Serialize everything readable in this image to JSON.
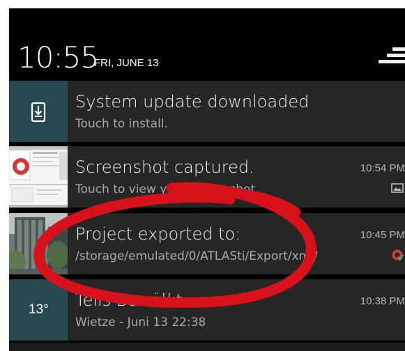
{
  "header": {
    "time": "10:55",
    "date": "FRI, JUNE 13"
  },
  "notifications": [
    {
      "title": "System update downloaded",
      "subtitle": "Touch to install.",
      "time": "",
      "icon": "download-icon"
    },
    {
      "title": "Screenshot captured.",
      "subtitle": "Touch to view your screenshot.",
      "time": "10:54 PM",
      "icon": "image-icon"
    },
    {
      "title": "Project exported to:",
      "subtitle": "/storage/emulated/0/ATLASti/Export/xml/",
      "time": "10:45 PM",
      "icon": "atlas-ti-icon"
    },
    {
      "title": "Teils Bewölkt",
      "subtitle": "Wietze - Juni 13  22:38",
      "time": "10:38 PM",
      "temperature": "13°",
      "icon": "weather-icon"
    }
  ],
  "colors": {
    "panel": "#262626",
    "accent_teal": "#26494f",
    "annotation_red": "#d8121b"
  }
}
